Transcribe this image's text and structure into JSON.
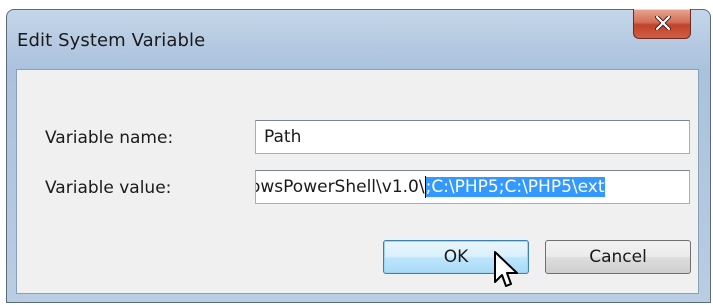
{
  "window": {
    "title": "Edit System Variable"
  },
  "form": {
    "name_label": "Variable name:",
    "name_value": "Path",
    "value_label": "Variable value:",
    "value_unselected": "owsPowerShell\\v1.0\\",
    "value_selected": ";C:\\PHP5;C:\\PHP5\\ext"
  },
  "buttons": {
    "ok": "OK",
    "cancel": "Cancel"
  },
  "icons": {
    "close": "close-x-icon",
    "cursor": "mouse-pointer-icon"
  },
  "colors": {
    "selection": "#3399ff",
    "close_button": "#c7462e"
  }
}
